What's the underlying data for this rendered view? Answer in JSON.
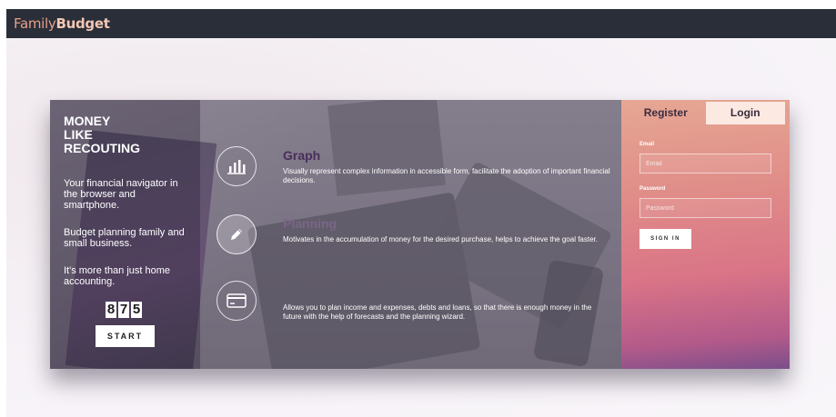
{
  "app": {
    "brand_part1": "Family",
    "brand_part2": "Budget"
  },
  "colors": {
    "topbar": "#2a2e38",
    "accent": "#e7a08a",
    "feature_title": "#4a2e5a"
  },
  "hero": {
    "title_line1": "MONEY",
    "title_line2": "LIKE",
    "title_line3": "RECOUTING",
    "text1": "Your financial navigator in the browser and smartphone.",
    "text2": "Budget planning family and small business.",
    "text3": "It's more than just home accounting.",
    "counter_digits": [
      "8",
      "7",
      "5"
    ],
    "start_label": "START"
  },
  "features": [
    {
      "icon": "bar-chart-icon",
      "title": "Graph",
      "description": "Visually represent complex information in accessible form, facilitate the adoption of important financial decisions."
    },
    {
      "icon": "pencil-icon",
      "title": "Planning",
      "description": "Motivates in the accumulation of money for the desired purchase, helps to achieve the goal faster."
    },
    {
      "icon": "credit-card-icon",
      "title": "",
      "description": "Allows you to plan income and expenses, debts and loans, so that there is enough money in the future with the help of forecasts and the planning wizard."
    }
  ],
  "auth": {
    "tab_register": "Register",
    "tab_login": "Login",
    "email_label": "Email",
    "email_placeholder": "Email",
    "password_label": "Password",
    "password_placeholder": "Password",
    "signin_label": "SIGN IN"
  }
}
